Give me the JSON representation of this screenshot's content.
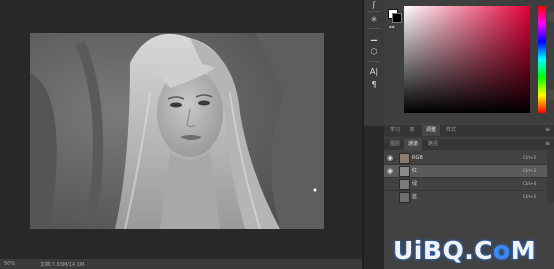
{
  "statusbar": {
    "zoom": "50%",
    "doc": "文档:7.03M/14.1M"
  },
  "tools": [
    {
      "icon": "hand-icon",
      "glyph": "ʃ"
    },
    {
      "icon": "light-icon",
      "glyph": "✳"
    },
    {
      "icon": "ruler-icon",
      "glyph": "▁"
    },
    {
      "icon": "cube-icon",
      "glyph": "⬡"
    },
    {
      "icon": "text-icon",
      "glyph": "A|"
    },
    {
      "icon": "paragraph-icon",
      "glyph": "¶"
    }
  ],
  "color_panel": {
    "mini_label": "▪▪",
    "fg": "#ffffff",
    "bg": "#000000"
  },
  "mid_tabs": {
    "items": [
      "学习",
      "库",
      "调整",
      "样式"
    ],
    "active": 2
  },
  "channel_tabs": {
    "items": [
      "图层",
      "通道",
      "路径"
    ],
    "active": 1
  },
  "menu_glyph": "≡",
  "channels": [
    {
      "name": "RGB",
      "shortcut": "Ctrl+2",
      "visible": true,
      "selected": false
    },
    {
      "name": "红",
      "shortcut": "Ctrl+3",
      "visible": true,
      "selected": true
    },
    {
      "name": "绿",
      "shortcut": "Ctrl+4",
      "visible": false,
      "selected": false
    },
    {
      "name": "蓝",
      "shortcut": "Ctrl+5",
      "visible": false,
      "selected": false
    }
  ],
  "eye_glyph": "◉",
  "watermark": {
    "part1": "UiB",
    "part2": "Q.C",
    "part3": "o",
    "part4": "M"
  }
}
